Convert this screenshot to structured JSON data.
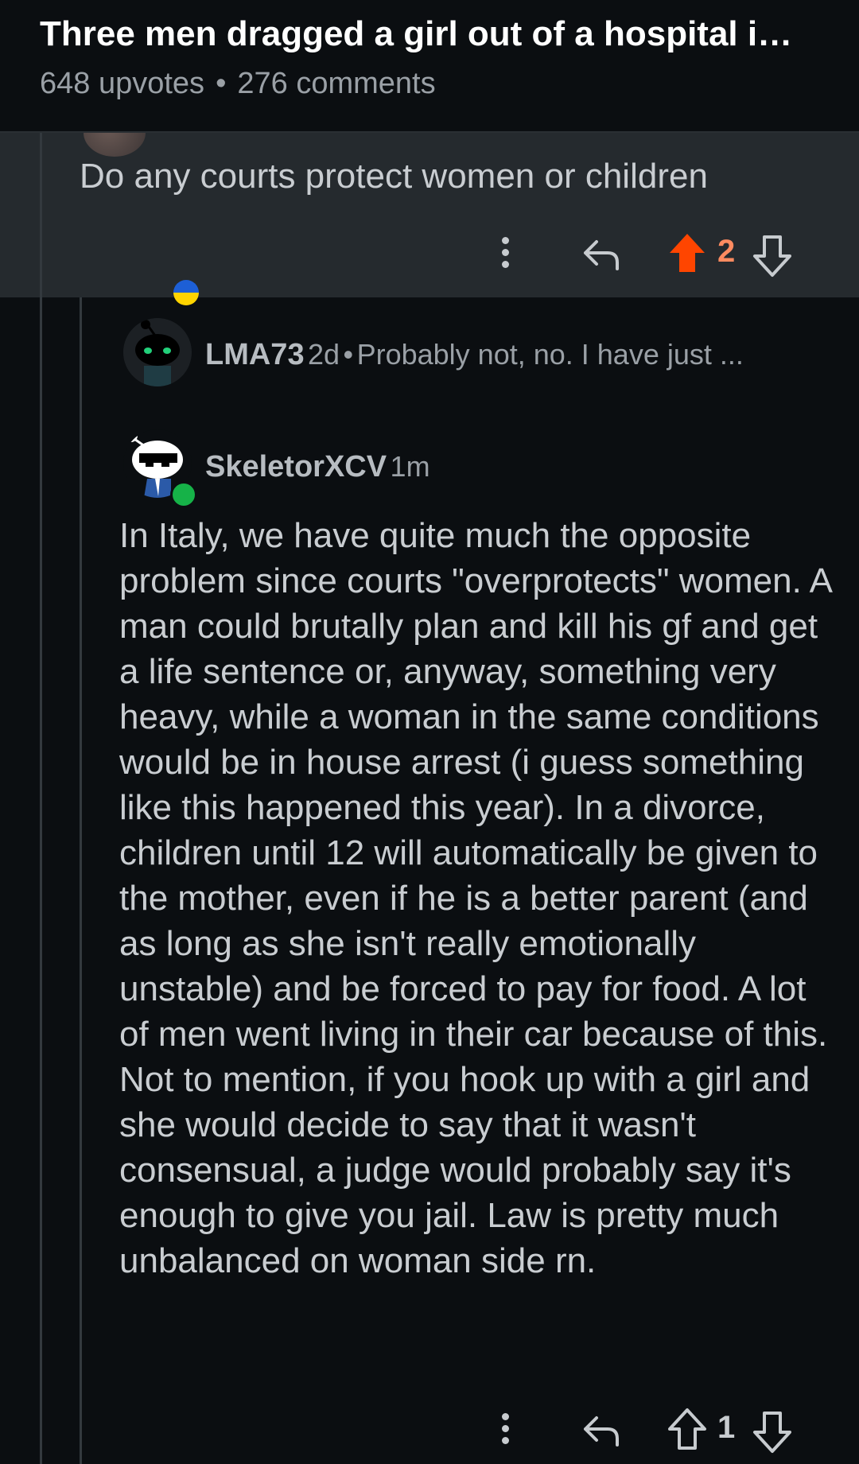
{
  "post": {
    "title": "Three men dragged a girl out of a hospital i…",
    "upvotes": "648 upvotes",
    "separator": "•",
    "comments": "276 comments"
  },
  "parent_comment": {
    "text": "Do any courts protect women or children",
    "score": "2",
    "vote_state": "upvoted",
    "accent": "#ff4500"
  },
  "collapsed_comment": {
    "username": "LMA73",
    "age": "2d",
    "separator": "•",
    "preview": "Probably not, no. I have just ..."
  },
  "reply": {
    "username": "SkeletorXCV",
    "age": "1m",
    "text": "In Italy, we have quite much the opposite problem since courts \"overprotects\" women. A man could brutally plan and kill his gf and get a life sentence or, anyway, something very heavy, while a woman in the same conditions would be in house arrest (i guess something like this happened this year). In a divorce, children until 12 will automatically be given to the mother, even if he is a better parent (and as long as she isn't really emotionally unstable) and be forced to pay for food. A lot of men went living in their car because of this. Not to mention, if you hook up with a girl and she would decide to say that it wasn't consensual, a judge would probably say it's enough to give you jail. Law is pretty much unbalanced on woman side rn.",
    "score": "1"
  },
  "icons": {
    "more": "more-vertical-icon",
    "reply": "reply-arrow-icon",
    "upvote": "upvote-arrow-icon",
    "downvote": "downvote-arrow-icon",
    "flag": "ukraine-flag-icon",
    "online": "online-status-icon"
  }
}
